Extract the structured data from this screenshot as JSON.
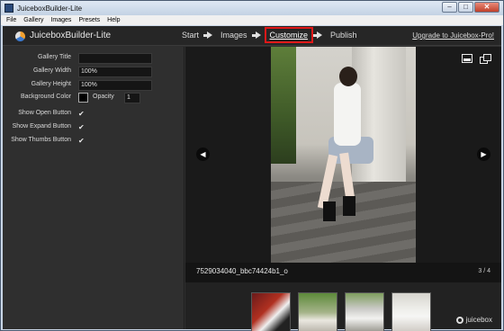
{
  "window": {
    "title": "JuiceboxBuilder-Lite",
    "minimize": "–",
    "maximize": "□",
    "close": "✕"
  },
  "menu": [
    "File",
    "Gallery",
    "Images",
    "Presets",
    "Help"
  ],
  "header": {
    "app_name": "JuiceboxBuilder-Lite",
    "steps": [
      "Start",
      "Images",
      "Customize",
      "Publish"
    ],
    "active_step": "Customize",
    "upgrade_link": "Upgrade to Juicebox-Pro!"
  },
  "settings": {
    "gallery_title": {
      "label": "Gallery Title",
      "value": ""
    },
    "gallery_width": {
      "label": "Gallery Width",
      "value": "100%"
    },
    "gallery_height": {
      "label": "Gallery Height",
      "value": "100%"
    },
    "background_color": {
      "label": "Background Color",
      "color": "#000000"
    },
    "opacity": {
      "label": "Opacity",
      "value": "1"
    },
    "show_open_button": {
      "label": "Show Open Button",
      "checked": true
    },
    "show_expand_button": {
      "label": "Show Expand Button",
      "checked": true
    },
    "show_thumbs_button": {
      "label": "Show Thumbs Button",
      "checked": true
    }
  },
  "preview": {
    "caption": "7529034040_bbc74424b1_o",
    "counter": "3 / 4",
    "thumbnails": [
      "thumb-1",
      "thumb-2",
      "thumb-3",
      "thumb-4"
    ],
    "brand": "juicebox"
  },
  "icons": {
    "check": "✔",
    "prev": "◀",
    "next": "▶"
  },
  "colors": {
    "accent_highlight": "#e01818",
    "app_background": "#2f2f2f"
  }
}
